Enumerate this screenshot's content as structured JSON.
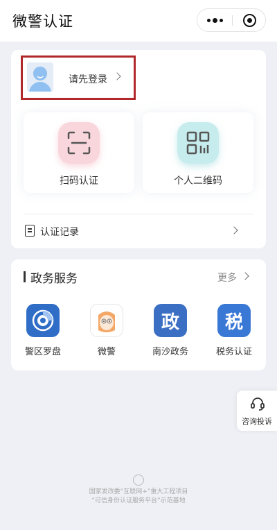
{
  "app": {
    "title": "微警认证"
  },
  "login": {
    "label": "请先登录"
  },
  "tiles": [
    {
      "label": "扫码认证",
      "icon": "scan-frame-icon",
      "color": "#f9d6dc"
    },
    {
      "label": "个人二维码",
      "icon": "qr-code-icon",
      "color": "#c6ecee"
    }
  ],
  "record": {
    "label": "认证记录"
  },
  "gov": {
    "title": "政务服务",
    "more": "更多",
    "services": [
      {
        "label": "警区罗盘",
        "icon": "compass-icon",
        "color": "#2f6dc7"
      },
      {
        "label": "微警",
        "icon": "weijing-mascot-icon"
      },
      {
        "label": "南沙政务",
        "icon": "zheng-char-icon",
        "glyph": "政",
        "color": "#3b6fc4"
      },
      {
        "label": "税务认证",
        "icon": "shui-char-icon",
        "glyph": "税",
        "color": "#3a78d6"
      }
    ]
  },
  "complaint": {
    "label": "咨询投诉"
  },
  "footer": {
    "line1": "国家发改委“互联网+”重大工程项目",
    "line2": "“可信身份认证服务平台”示范基地"
  }
}
